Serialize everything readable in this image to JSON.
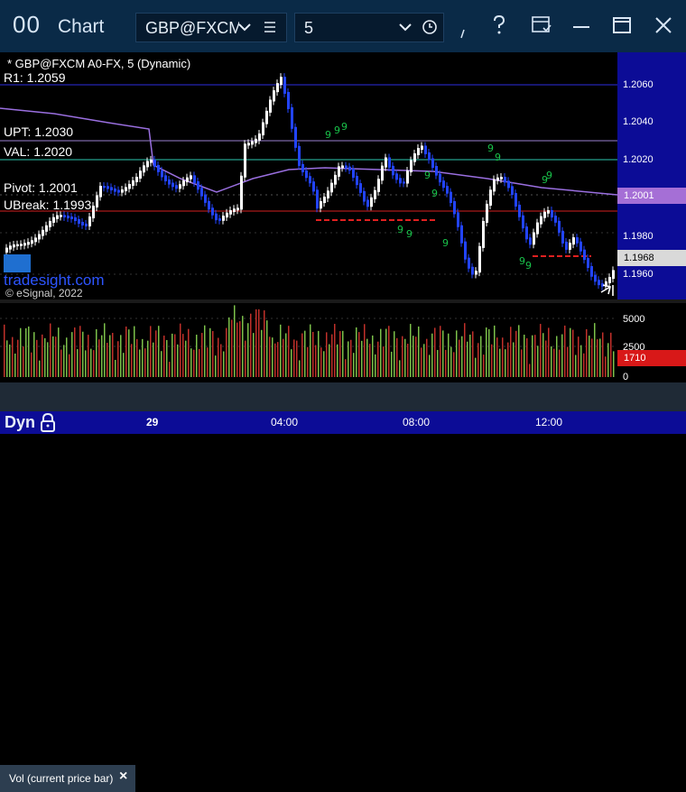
{
  "titlebar": {
    "logo": "00",
    "title": "Chart",
    "symbol": "GBP@FXCM",
    "interval": "5"
  },
  "chart": {
    "header": "* GBP@FXCM A0-FX, 5 (Dynamic)",
    "levels": {
      "r1": "R1: 1.2059",
      "upt": "UPT: 1.2030",
      "val": "VAL: 1.2020",
      "pivot": "Pivot: 1.2001",
      "ubreak": "UBreak: 1.1993"
    },
    "watermark": "tradesight.com",
    "copyright": "© eSignal, 2022",
    "price_ticks": [
      "1.2060",
      "1.2040",
      "1.2020",
      "1.1980",
      "1.1960"
    ],
    "pivot_tag": "1.2001",
    "last_tag": "1.1968",
    "colors": {
      "up_candle": "#ffffff",
      "down_candle": "#2244ff",
      "r1_line": "#2d2de0",
      "upt_line": "#9a7fd0",
      "val_line": "#2ec7b0",
      "ubreak_line": "#d42020",
      "ma_line": "#9a6fe0",
      "pivot_tag_bg": "#a56fd6",
      "last_tag_bg": "#d9d9d9"
    }
  },
  "volume": {
    "ticks": [
      "5000",
      "2500",
      "0"
    ],
    "last_value": "1710",
    "panel_label": "Vol (current price bar)",
    "close_label": "×",
    "colors": {
      "up": "#7cc04a",
      "down": "#c0302a",
      "tag_bg": "#d81818"
    }
  },
  "timebar": {
    "dyn": "Dyn",
    "labels": [
      "29",
      "04:00",
      "08:00",
      "12:00"
    ]
  }
}
